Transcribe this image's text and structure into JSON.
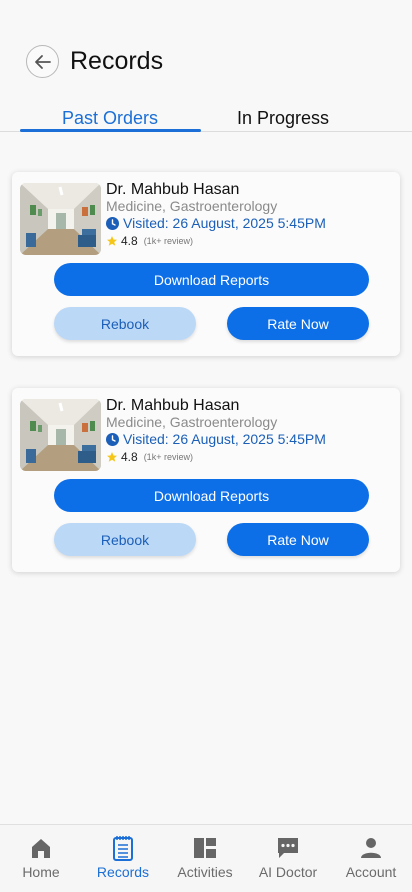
{
  "header": {
    "title": "Records",
    "back_icon": "arrow-left-icon"
  },
  "tabs": [
    {
      "label": "Past Orders",
      "active": true
    },
    {
      "label": "In Progress",
      "active": false
    }
  ],
  "records": [
    {
      "doctor_name": "Dr. Mahbub Hasan",
      "specialty": "Medicine, Gastroenterology",
      "visited": "Visited: 26 August, 2025 5:45PM",
      "rating": "4.8",
      "reviews": "(1k+ review)",
      "download_label": "Download Reports",
      "rebook_label": "Rebook",
      "rate_label": "Rate Now"
    },
    {
      "doctor_name": "Dr. Mahbub Hasan",
      "specialty": "Medicine, Gastroenterology",
      "visited": "Visited: 26 August, 2025 5:45PM",
      "rating": "4.8",
      "reviews": "(1k+ review)",
      "download_label": "Download Reports",
      "rebook_label": "Rebook",
      "rate_label": "Rate Now"
    }
  ],
  "bottom_nav": [
    {
      "label": "Home",
      "icon": "home-icon",
      "active": false
    },
    {
      "label": "Records",
      "icon": "records-icon",
      "active": true
    },
    {
      "label": "Activities",
      "icon": "activities-icon",
      "active": false
    },
    {
      "label": "AI Doctor",
      "icon": "chat-icon",
      "active": false
    },
    {
      "label": "Account",
      "icon": "account-icon",
      "active": false
    }
  ],
  "colors": {
    "accent": "#0d6fe8",
    "accent_text": "#1b6fd6",
    "rebook_bg": "#bcd8f7",
    "star": "#f5c518"
  }
}
